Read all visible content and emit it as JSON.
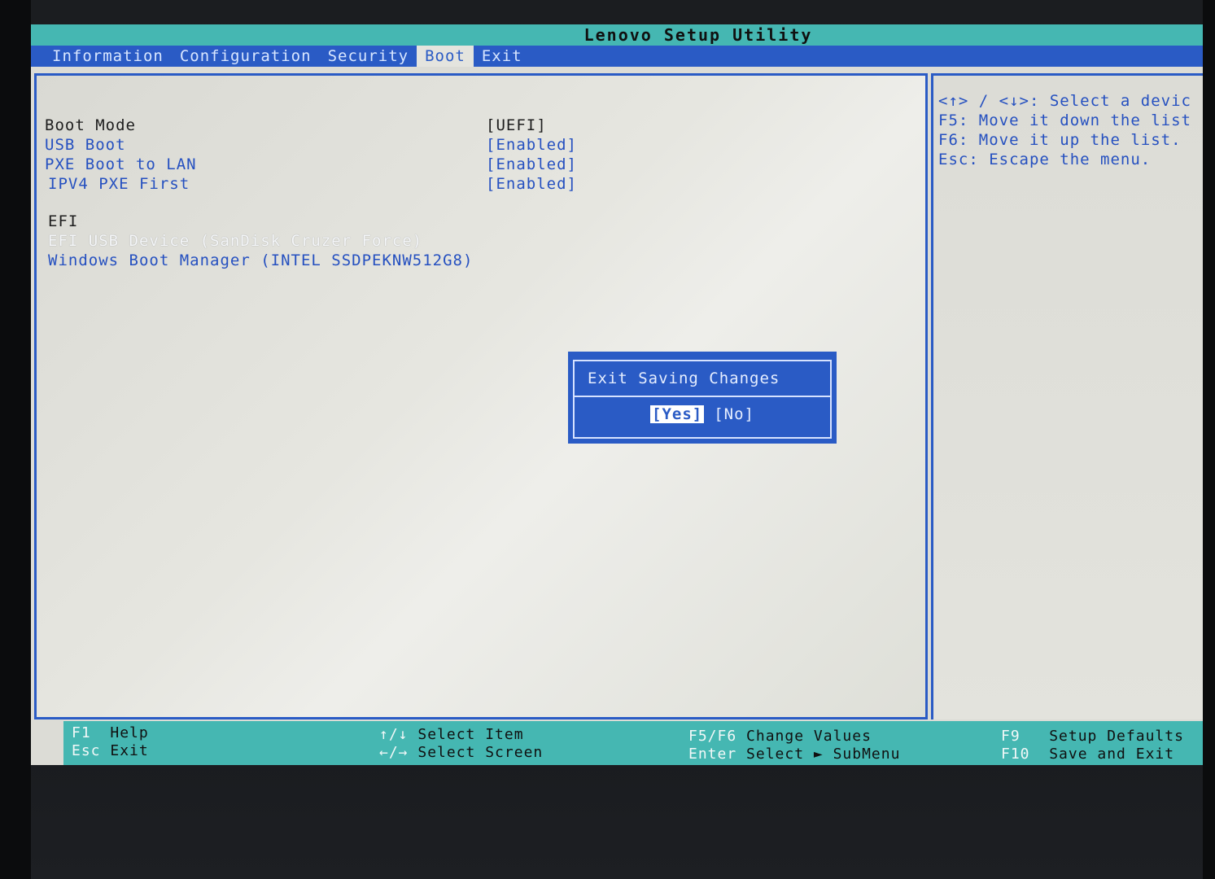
{
  "title": "Lenovo Setup Utility",
  "menu": [
    {
      "label": "Information",
      "active": false
    },
    {
      "label": "Configuration",
      "active": false
    },
    {
      "label": "Security",
      "active": false
    },
    {
      "label": "Boot",
      "active": true
    },
    {
      "label": "Exit",
      "active": false
    }
  ],
  "settings": {
    "boot_mode": {
      "label": "Boot Mode",
      "value": "[UEFI]"
    },
    "usb_boot": {
      "label": "USB Boot",
      "value": "[Enabled]"
    },
    "pxe_boot": {
      "label": "PXE Boot to LAN",
      "value": "[Enabled]"
    },
    "ipv4_pxe": {
      "label": "IPV4 PXE First",
      "value": "[Enabled]"
    }
  },
  "efi": {
    "heading": "EFI",
    "devices": [
      "EFI USB Device (SanDisk Cruzer Force)",
      "Windows Boot Manager (INTEL SSDPEKNW512G8)"
    ]
  },
  "help": [
    "<↑> / <↓>: Select a devic",
    "F5: Move it down the list",
    "F6: Move it up the list.",
    "Esc: Escape the menu."
  ],
  "dialog": {
    "title": "Exit Saving Changes",
    "yes": "[Yes]",
    "no": "[No]"
  },
  "footer": {
    "f1_key": "F1",
    "f1_label": "Help",
    "esc_key": "Esc",
    "esc_label": "Exit",
    "updown_key": "↑/↓",
    "updown_label": "Select Item",
    "leftright_key": "←/→",
    "leftright_label": "Select Screen",
    "f5f6_key": "F5/F6",
    "f5f6_label": "Change Values",
    "enter_key": "Enter",
    "enter_label": "Select ► SubMenu",
    "f9_key": "F9",
    "f9_label": "Setup Defaults",
    "f10_key": "F10",
    "f10_label": "Save and Exit"
  },
  "colors": {
    "menu_bar": "#2a5bc5",
    "title_bar": "#45b7b2",
    "background": "#dcdcd6"
  }
}
